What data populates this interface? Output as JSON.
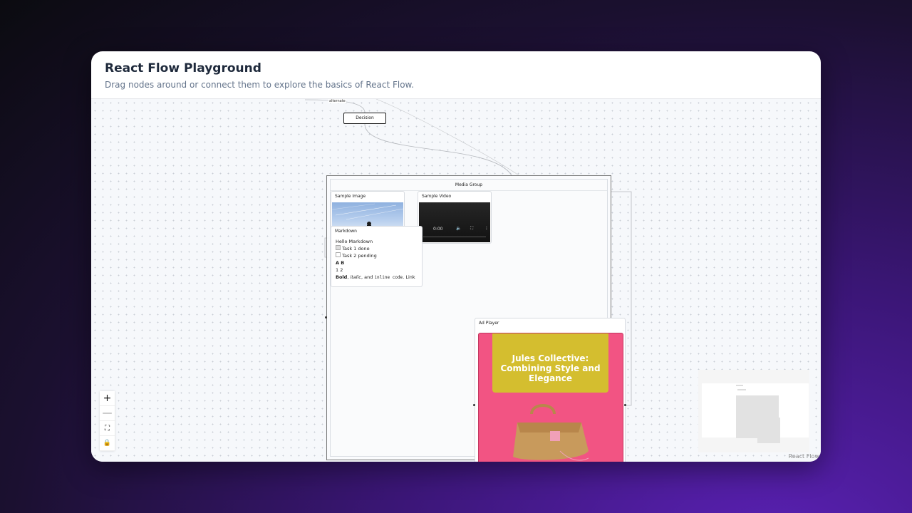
{
  "header": {
    "title": "React Flow Playground",
    "subtitle": "Drag nodes around or connect them to explore the basics of React Flow."
  },
  "edges": {
    "label": "alternate"
  },
  "nodes": {
    "decision": "Decision",
    "group": "Media Group",
    "image": "Sample Image",
    "video": {
      "title": "Sample Video",
      "time": "0:00"
    },
    "markdown": {
      "title": "Markdown",
      "heading": "Hello Markdown",
      "task1": "Task 1 done",
      "task2": "Task 2 pending",
      "table_header": "A B",
      "table_row": "1 2",
      "bold": "Bold",
      "italic": "italic",
      "and": ", and",
      "code": "inline code",
      "link": "Link"
    },
    "ad": {
      "title": "Ad Player",
      "headline": "Jules Collective: Combining Style and Elegance"
    }
  },
  "controls": {
    "zoom_in": "+",
    "zoom_out": "—",
    "fit": "⛶",
    "lock": "🔒"
  },
  "attribution": "React Flow",
  "colors": {
    "accent": "#f25483",
    "banner": "#d4be2f"
  }
}
